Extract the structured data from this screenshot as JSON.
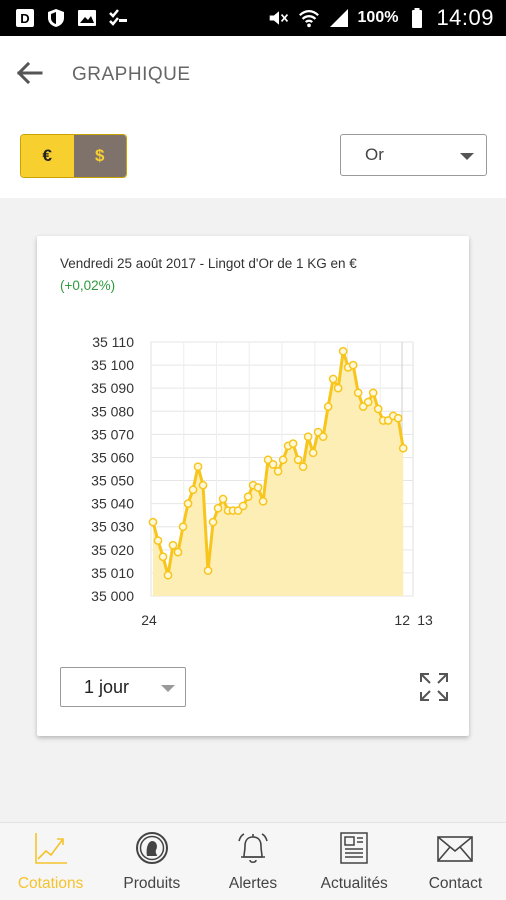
{
  "status_bar": {
    "battery": "100%",
    "time": "14:09"
  },
  "app_bar": {
    "title": "GRAPHIQUE",
    "currency": {
      "options": [
        "€",
        "$"
      ],
      "selected": "€"
    },
    "metal_select": {
      "value": "Or"
    }
  },
  "card": {
    "title": "Vendredi 25 août 2017 - Lingot d'Or de 1 KG en €",
    "change": "(+0,02%)",
    "period_select": {
      "value": "1 jour"
    }
  },
  "chart_data": {
    "type": "area",
    "x_ticks": [
      "24",
      "12",
      "13"
    ],
    "y_ticks": [
      "35 000",
      "35 010",
      "35 020",
      "35 030",
      "35 040",
      "35 050",
      "35 060",
      "35 070",
      "35 080",
      "35 090",
      "35 100",
      "35 110"
    ],
    "ylim": [
      35000,
      35110
    ],
    "grid": true,
    "color_line": "#f7c51c",
    "color_fill": "#fdeeb5",
    "values": [
      35032,
      35024,
      35017,
      35009,
      35022,
      35019,
      35030,
      35040,
      35046,
      35056,
      35048,
      35011,
      35032,
      35038,
      35042,
      35037,
      35037,
      35037,
      35039,
      35043,
      35048,
      35047,
      35041,
      35059,
      35057,
      35054,
      35059,
      35065,
      35066,
      35059,
      35056,
      35069,
      35062,
      35071,
      35069,
      35082,
      35094,
      35090,
      35106,
      35099,
      35100,
      35088,
      35082,
      35084,
      35088,
      35081,
      35076,
      35076,
      35078,
      35077,
      35064
    ]
  },
  "bottom_nav": {
    "items": [
      {
        "label": "Cotations",
        "icon": "chart-icon",
        "active": true
      },
      {
        "label": "Produits",
        "icon": "coin-icon",
        "active": false
      },
      {
        "label": "Alertes",
        "icon": "bell-icon",
        "active": false
      },
      {
        "label": "Actualités",
        "icon": "newspaper-icon",
        "active": false
      },
      {
        "label": "Contact",
        "icon": "envelope-icon",
        "active": false
      }
    ],
    "active_color": "#f5c32c"
  }
}
